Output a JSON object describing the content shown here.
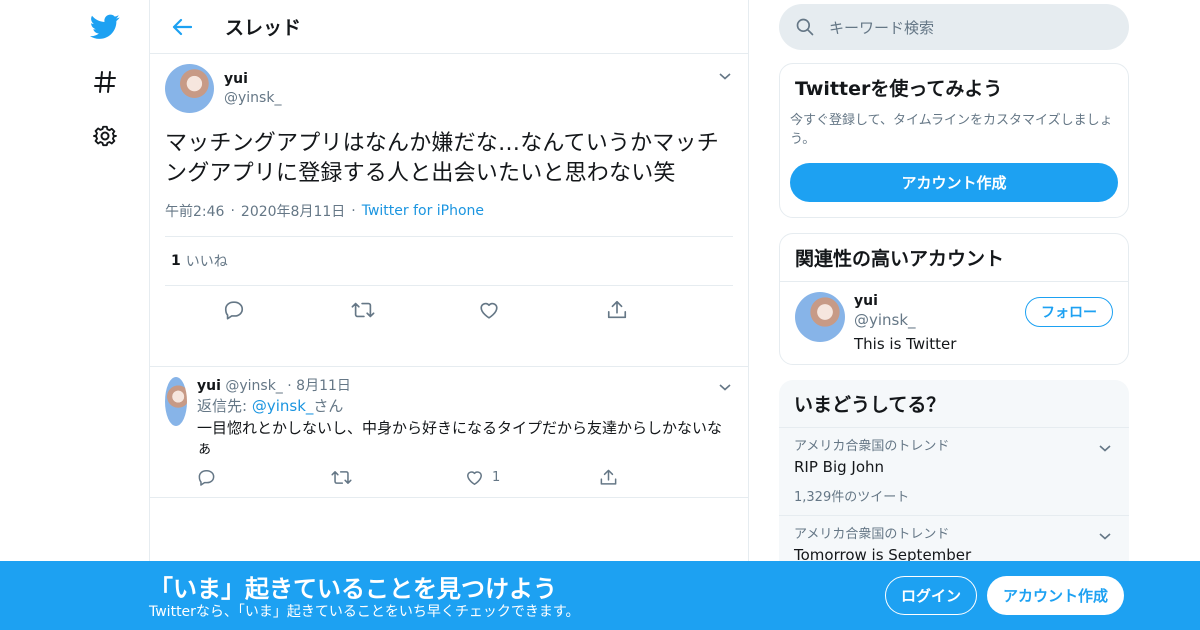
{
  "nav": {
    "icons": [
      "twitter-bird-icon",
      "hashtag-icon",
      "gear-icon"
    ]
  },
  "header": {
    "title": "スレッド"
  },
  "focal_tweet": {
    "name": "yui",
    "handle": "@yinsk_",
    "text": "マッチングアプリはなんか嫌だな…なんていうかマッチングアプリに登録する人と出会いたいと思わない笑",
    "time": "午前2:46",
    "date": "2020年8月11日",
    "source": "Twitter for iPhone",
    "likes_count": "1",
    "likes_label": "いいね"
  },
  "reply_tweet": {
    "name": "yui",
    "handle": "@yinsk_",
    "date": "8月11日",
    "reply_prefix": "返信先: ",
    "reply_to": "@yinsk_",
    "reply_suffix": "さん",
    "text": "一目惚れとかしないし、中身から好きになるタイプだから友達からしかないなぁ",
    "like_count": "1"
  },
  "search": {
    "placeholder": "キーワード検索"
  },
  "signup_card": {
    "title": "Twitterを使ってみよう",
    "desc": "今すぐ登録して、タイムラインをカスタマイズしましょう。",
    "button": "アカウント作成"
  },
  "related": {
    "title": "関連性の高いアカウント",
    "name": "yui",
    "handle": "@yinsk_",
    "bio": "This is Twitter",
    "follow": "フォロー"
  },
  "trends": {
    "title": "いまどうしてる？",
    "items": [
      {
        "context": "アメリカ合衆国のトレンド",
        "name": "RIP Big John",
        "count": "1,329件のツイート"
      },
      {
        "context": "アメリカ合衆国のトレンド",
        "name": "Tomorrow is September",
        "count": ""
      }
    ]
  },
  "bottom_bar": {
    "title": "「いま」起きていることを見つけよう",
    "subtitle": "Twitterなら、「いま」起きていることをいち早くチェックできます。",
    "login": "ログイン",
    "signup": "アカウント作成"
  },
  "colors": {
    "brand": "#1da1f2",
    "link": "#1b95e0",
    "muted": "#657786",
    "border": "#e6ecf0"
  }
}
